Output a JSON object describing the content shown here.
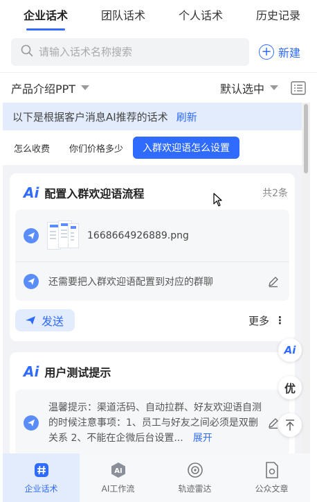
{
  "top_tabs": [
    {
      "label": "企业话术",
      "active": true
    },
    {
      "label": "团队话术",
      "active": false
    },
    {
      "label": "个人话术",
      "active": false
    },
    {
      "label": "历史记录",
      "active": false
    }
  ],
  "search": {
    "placeholder": "请输入话术名称搜索",
    "new_label": "新建"
  },
  "filter": {
    "category": "产品介绍PPT",
    "selection": "默认选中"
  },
  "ai_banner": {
    "text": "以下是根据客户消息AI推荐的话术",
    "refresh_label": "刷新"
  },
  "chips": [
    {
      "label": "怎么收费",
      "active": false
    },
    {
      "label": "你们价格多少",
      "active": false
    },
    {
      "label": "入群欢迎语怎么设置",
      "active": true
    }
  ],
  "cards": [
    {
      "ai_badge": "Ai",
      "title": "配置入群欢迎语流程",
      "count": "共2条",
      "items": [
        {
          "type": "image",
          "text": "1668664926889.png"
        },
        {
          "type": "text",
          "text": "还需要把入群欢迎语配置到对应的群聊"
        }
      ],
      "send_label": "发送",
      "more_label": "更多"
    },
    {
      "ai_badge": "Ai",
      "title": "用户测试提示",
      "items": [
        {
          "type": "text",
          "text": "温馨提示：渠道活码、自动拉群、好友欢迎语自测的时候注意事项：1、员工与好友之间必须是双删关系 2、不能在企微后台设置...",
          "expand_label": "展开"
        }
      ]
    }
  ],
  "floating": {
    "ai_label": "Ai",
    "you_label": "优"
  },
  "bottom_nav": [
    {
      "label": "企业话术",
      "active": true,
      "icon": "hash-icon"
    },
    {
      "label": "AI工作流",
      "active": false,
      "icon": "ai-workflow-icon"
    },
    {
      "label": "轨迹雷达",
      "active": false,
      "icon": "radar-icon"
    },
    {
      "label": "公众文章",
      "active": false,
      "icon": "article-icon"
    }
  ],
  "colors": {
    "accent": "#2f6bff",
    "banner_bg": "#e3ecfc",
    "content_bg": "#f1f3f6"
  }
}
